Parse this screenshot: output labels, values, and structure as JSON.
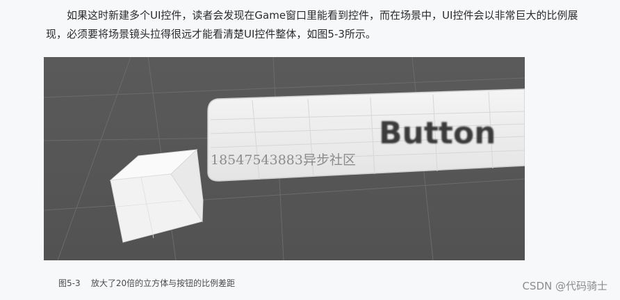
{
  "article": {
    "paragraph": "如果这时新建多个UI控件，读者会发现在Game窗口里能看到控件，而在场景中，UI控件会以非常巨大的比例展现，必须要将场景镜头拉得很远才能看清楚UI控件整体，如图5-3所示。"
  },
  "figure": {
    "button_label": "Button",
    "watermark": "18547543883异步社区",
    "caption": "图5-3    放大了20倍的立方体与按钮的比例差距"
  },
  "footer": {
    "credit": "CSDN @代码骑士"
  },
  "colors": {
    "scene_background": "#555555",
    "grid_line": "#6a6a6a",
    "cube_light": "#f4f4f4",
    "button_fill": "#f0f0f0"
  }
}
